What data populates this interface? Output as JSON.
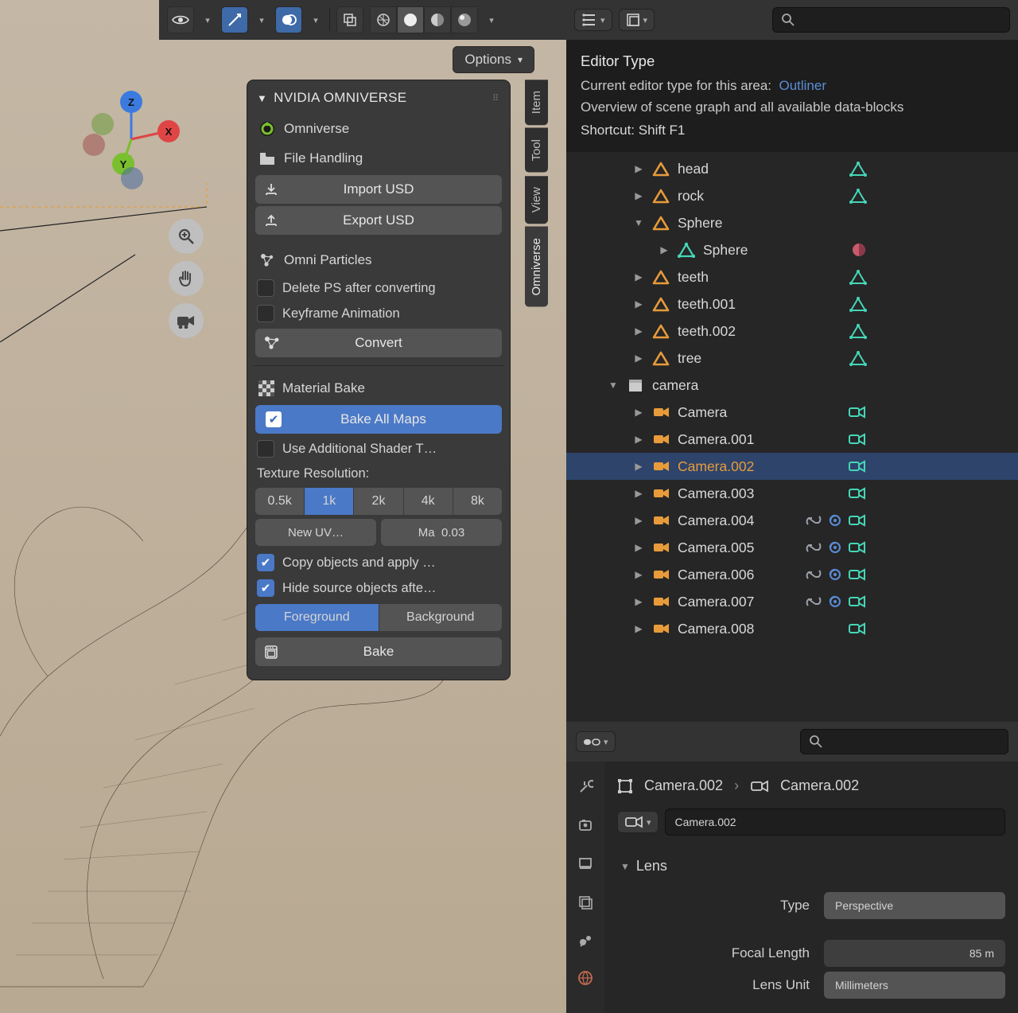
{
  "toolbar": {
    "options_label": "Options"
  },
  "vtabs": [
    "Item",
    "Tool",
    "View",
    "Omniverse"
  ],
  "panel": {
    "title": "NVIDIA OMNIVERSE",
    "omniverse_label": "Omniverse",
    "file_handling_label": "File Handling",
    "import_usd": "Import USD",
    "export_usd": "Export USD",
    "omni_particles_label": "Omni Particles",
    "delete_ps": "Delete PS after converting",
    "keyframe_anim": "Keyframe Animation",
    "convert": "Convert",
    "material_bake_label": "Material Bake",
    "bake_all_maps": "Bake All Maps",
    "use_additional": "Use Additional Shader T…",
    "texture_res_label": "Texture Resolution:",
    "res_options": [
      "0.5k",
      "1k",
      "2k",
      "4k",
      "8k"
    ],
    "res_selected": "1k",
    "new_uv": "New UV…",
    "ma_label": "Ma",
    "ma_value": "0.03",
    "copy_objects": "Copy objects and apply …",
    "hide_source": "Hide source objects afte…",
    "foreground": "Foreground",
    "background": "Background",
    "bake": "Bake"
  },
  "tooltip": {
    "title": "Editor Type",
    "line1_a": "Current editor type for this area:",
    "line1_b": "Outliner",
    "line2": "Overview of scene graph and all available data-blocks",
    "shortcut_label": "Shortcut:",
    "shortcut_value": "Shift F1"
  },
  "outliner": {
    "items": [
      {
        "indent": 2,
        "arrow": "▶",
        "icon": "tri",
        "label": "head",
        "badges": [
          "mesh"
        ]
      },
      {
        "indent": 2,
        "arrow": "▶",
        "icon": "tri",
        "label": "rock",
        "badges": [
          "mesh"
        ]
      },
      {
        "indent": 2,
        "arrow": "▼",
        "icon": "tri",
        "label": "Sphere",
        "badges": []
      },
      {
        "indent": 3,
        "arrow": "▶",
        "icon": "mesh",
        "label": "Sphere",
        "badges": [
          "mat-red"
        ]
      },
      {
        "indent": 2,
        "arrow": "▶",
        "icon": "tri",
        "label": "teeth",
        "badges": [
          "mesh"
        ]
      },
      {
        "indent": 2,
        "arrow": "▶",
        "icon": "tri",
        "label": "teeth.001",
        "badges": [
          "mesh"
        ]
      },
      {
        "indent": 2,
        "arrow": "▶",
        "icon": "tri",
        "label": "teeth.002",
        "badges": [
          "mesh"
        ]
      },
      {
        "indent": 2,
        "arrow": "▶",
        "icon": "tri",
        "label": "tree",
        "badges": [
          "mesh"
        ]
      },
      {
        "indent": 1,
        "arrow": "▼",
        "icon": "coll",
        "label": "camera",
        "badges": []
      },
      {
        "indent": 2,
        "arrow": "▶",
        "icon": "cam",
        "label": "Camera",
        "badges": [
          "cam"
        ]
      },
      {
        "indent": 2,
        "arrow": "▶",
        "icon": "cam",
        "label": "Camera.001",
        "badges": [
          "cam"
        ]
      },
      {
        "indent": 2,
        "arrow": "▶",
        "icon": "cam",
        "label": "Camera.002",
        "badges": [
          "cam"
        ],
        "selected": true
      },
      {
        "indent": 2,
        "arrow": "▶",
        "icon": "cam",
        "label": "Camera.003",
        "badges": [
          "cam"
        ]
      },
      {
        "indent": 2,
        "arrow": "▶",
        "icon": "cam",
        "label": "Camera.004",
        "badges": [
          "link",
          "drv",
          "cam"
        ]
      },
      {
        "indent": 2,
        "arrow": "▶",
        "icon": "cam",
        "label": "Camera.005",
        "badges": [
          "link",
          "drv",
          "cam"
        ]
      },
      {
        "indent": 2,
        "arrow": "▶",
        "icon": "cam",
        "label": "Camera.006",
        "badges": [
          "link",
          "drv",
          "cam"
        ]
      },
      {
        "indent": 2,
        "arrow": "▶",
        "icon": "cam",
        "label": "Camera.007",
        "badges": [
          "link",
          "drv",
          "cam"
        ]
      },
      {
        "indent": 2,
        "arrow": "▶",
        "icon": "cam",
        "label": "Camera.008",
        "badges": [
          "cam"
        ]
      }
    ]
  },
  "props": {
    "crumb_obj": "Camera.002",
    "crumb_data": "Camera.002",
    "data_name": "Camera.002",
    "lens_label": "Lens",
    "type_label": "Type",
    "type_value": "Perspective",
    "focal_label": "Focal Length",
    "focal_value": "85 m",
    "unit_label": "Lens Unit",
    "unit_value": "Millimeters"
  }
}
